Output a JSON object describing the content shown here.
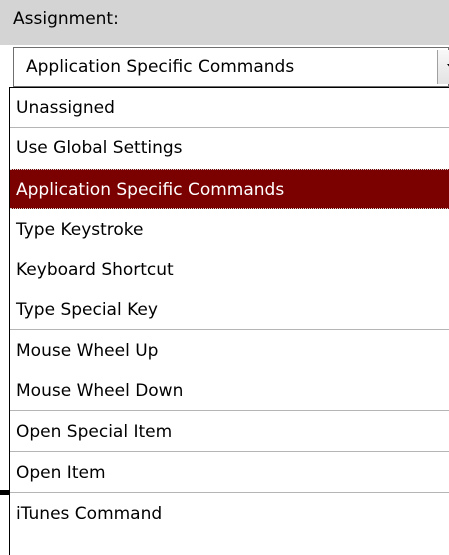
{
  "assignment": {
    "label": "Assignment:",
    "selected_value": "Application Specific Commands"
  },
  "dropdown": {
    "items": [
      {
        "label": "Unassigned"
      },
      {
        "label": "Use Global Settings"
      },
      {
        "label": "Application Specific Commands",
        "selected": true
      },
      {
        "label": "Type Keystroke"
      },
      {
        "label": "Keyboard Shortcut"
      },
      {
        "label": "Type Special Key"
      },
      {
        "label": "Mouse Wheel Up"
      },
      {
        "label": "Mouse Wheel Down"
      },
      {
        "label": "Open Special Item"
      },
      {
        "label": "Open Item"
      },
      {
        "label": "iTunes Command"
      }
    ]
  },
  "colors": {
    "selected_background": "#7b0000",
    "selected_text": "#ffffff",
    "header_background": "#d4d4d4"
  }
}
